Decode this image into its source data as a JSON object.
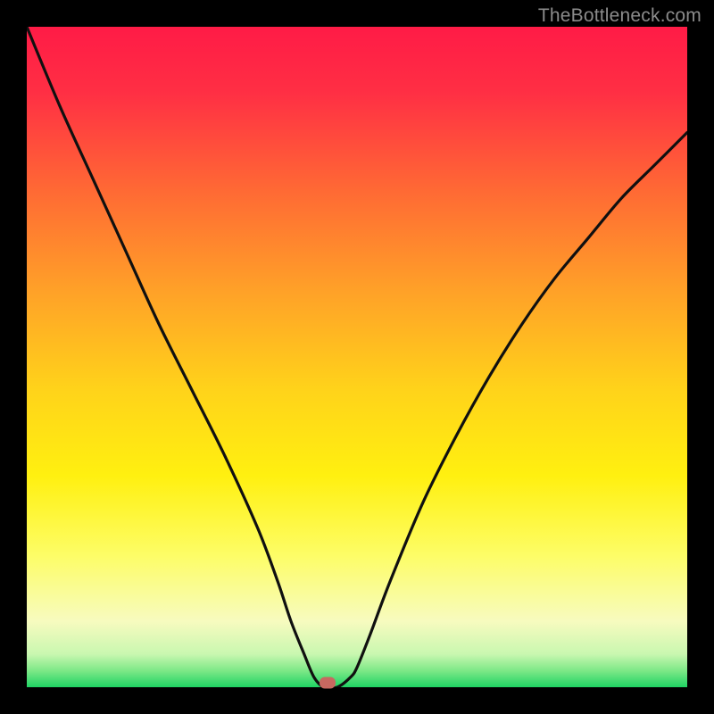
{
  "watermark": "TheBottleneck.com",
  "chart_data": {
    "type": "line",
    "title": "",
    "xlabel": "",
    "ylabel": "",
    "xlim": [
      0,
      100
    ],
    "ylim": [
      0,
      100
    ],
    "series": [
      {
        "name": "bottleneck-curve",
        "x": [
          0,
          5,
          10,
          15,
          20,
          25,
          30,
          35,
          38,
          40,
          42,
          43.5,
          45,
          47,
          49,
          50,
          52,
          55,
          60,
          65,
          70,
          75,
          80,
          85,
          90,
          95,
          100
        ],
        "values": [
          100,
          88,
          77,
          66,
          55,
          45,
          35,
          24,
          16,
          10,
          5,
          1.5,
          0,
          0,
          1.5,
          3,
          8,
          16,
          28,
          38,
          47,
          55,
          62,
          68,
          74,
          79,
          84
        ]
      }
    ],
    "marker": {
      "x": 45.5,
      "y": 0.7
    },
    "gradient_stops": [
      {
        "offset": 0.0,
        "color": "#ff1b46"
      },
      {
        "offset": 0.1,
        "color": "#ff2f44"
      },
      {
        "offset": 0.25,
        "color": "#ff6a34"
      },
      {
        "offset": 0.4,
        "color": "#ffa128"
      },
      {
        "offset": 0.55,
        "color": "#ffd31a"
      },
      {
        "offset": 0.68,
        "color": "#fff010"
      },
      {
        "offset": 0.8,
        "color": "#fdfd66"
      },
      {
        "offset": 0.9,
        "color": "#f7fbbf"
      },
      {
        "offset": 0.95,
        "color": "#c9f7b0"
      },
      {
        "offset": 0.975,
        "color": "#7de887"
      },
      {
        "offset": 1.0,
        "color": "#1fd363"
      }
    ]
  }
}
